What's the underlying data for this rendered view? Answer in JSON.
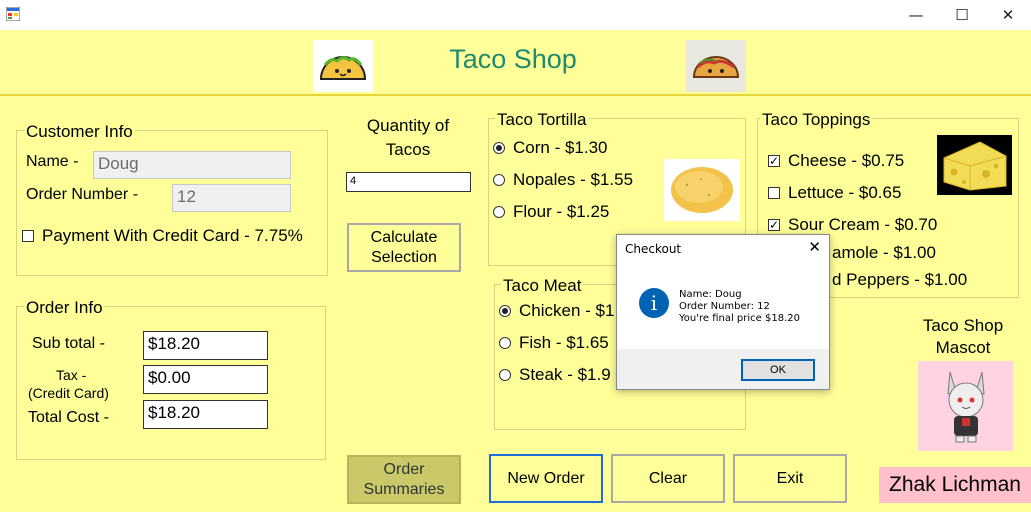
{
  "window": {
    "minimize_glyph": "—",
    "maximize_glyph": "☐",
    "close_glyph": "✕"
  },
  "header": {
    "title": "Taco Shop"
  },
  "customer_info": {
    "title": "Customer Info",
    "name_label": "Name -",
    "name_value": "Doug",
    "order_number_label": "Order  Number -",
    "order_number_value": "12",
    "credit_card_label": "Payment With Credit Card - 7.75%",
    "credit_card_checked": false
  },
  "order_info": {
    "title": "Order Info",
    "subtotal_label": "Sub total -",
    "subtotal_value": "$18.20",
    "tax_label": "Tax -",
    "tax_sub_label": "(Credit Card)",
    "tax_value": "$0.00",
    "total_label": "Total Cost -",
    "total_value": "$18.20"
  },
  "quantity": {
    "label_line1": "Quantity of",
    "label_line2": "Tacos",
    "value": "4"
  },
  "buttons": {
    "calculate_line1": "Calculate",
    "calculate_line2": "Selection",
    "order_summaries_line1": "Order",
    "order_summaries_line2": "Summaries",
    "new_order": "New Order",
    "clear": "Clear",
    "exit": "Exit"
  },
  "tortilla": {
    "title": "Taco Tortilla",
    "options": [
      "Corn - $1.30",
      "Nopales - $1.55",
      "Flour - $1.25"
    ],
    "selected": 0
  },
  "meat": {
    "title": "Taco Meat",
    "options": [
      "Chicken - $1",
      "Fish - $1.65",
      "Steak - $1.9"
    ],
    "selected": 0
  },
  "toppings": {
    "title": "Taco Toppings",
    "items": [
      {
        "label": "Cheese - $0.75",
        "checked": true
      },
      {
        "label": "Lettuce - $0.65",
        "checked": false
      },
      {
        "label": "Sour Cream - $0.70",
        "checked": true
      },
      {
        "label": "amole - $1.00"
      },
      {
        "label": "d Peppers - $1.00"
      }
    ]
  },
  "mascot": {
    "label_line1": "Taco Shop",
    "label_line2": "Mascot"
  },
  "author": "Zhak Lichman",
  "dialog": {
    "title": "Checkout",
    "line1": "Name: Doug",
    "line2": "Order Number: 12",
    "line3": "You're final price $18.20",
    "ok_label": "OK",
    "icon_glyph": "i"
  },
  "colors": {
    "background": "#ffff99",
    "title": "#1f8a70",
    "author_bg": "#ffc0cb",
    "dialog_icon": "#0063b1"
  }
}
